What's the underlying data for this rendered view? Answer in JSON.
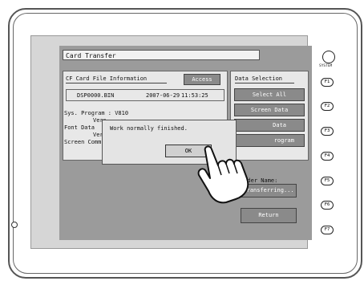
{
  "window": {
    "title": "Card Transfer"
  },
  "cf_panel": {
    "heading": "CF Card File Information",
    "access_label": "Access",
    "file_name": "DSP0000.BIN",
    "file_date": "2007-06-29",
    "file_time": "11:53:25",
    "sys_program": "Sys. Program   : V810",
    "vers1": "Vers",
    "font_data": "Font Data",
    "vers2": "Vers",
    "screen_comm": "Screen Comm"
  },
  "data_selection": {
    "heading": "Data Selection",
    "select_all": "Select All",
    "screen_data": "Screen Data",
    "data_partial": "Data",
    "program_partial": "rogram"
  },
  "folder": {
    "label_partial": "older Name:",
    "value_partial": "Transferring..."
  },
  "return_label": "Return",
  "dialog": {
    "message": "Work normally finished.",
    "ok_label": "OK"
  },
  "side_keys": [
    "F1",
    "F2",
    "F3",
    "F4",
    "F5",
    "F6",
    "F7"
  ],
  "system_label": "SYSTEM"
}
